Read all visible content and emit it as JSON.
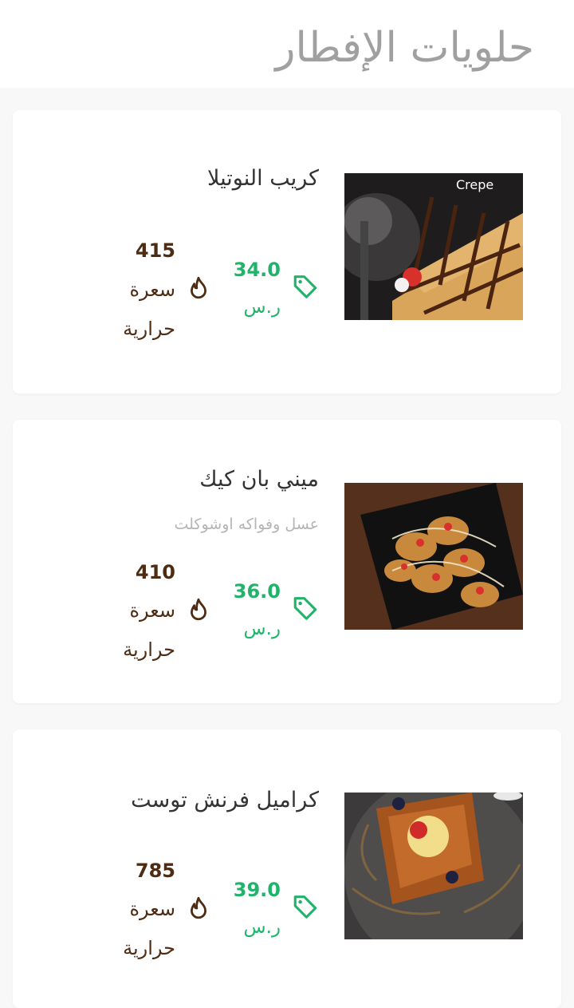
{
  "section": {
    "title": "حلويات الإفطار"
  },
  "colors": {
    "price": "#22b36b",
    "calories": "#4e2c14",
    "title": "#a0a0a0"
  },
  "items": [
    {
      "name": "كريب النوتيلا",
      "description": "",
      "price": "34.0",
      "currency": "ر.س",
      "calories": "415",
      "calories_unit_1": "سعرة",
      "calories_unit_2": "حرارية",
      "image_label": "Crepe"
    },
    {
      "name": "ميني بان كيك",
      "description": "عسل وفواكه اوشوكلت",
      "price": "36.0",
      "currency": "ر.س",
      "calories": "410",
      "calories_unit_1": "سعرة",
      "calories_unit_2": "حرارية"
    },
    {
      "name": "كراميل فرنش توست",
      "description": "",
      "price": "39.0",
      "currency": "ر.س",
      "calories": "785",
      "calories_unit_1": "سعرة",
      "calories_unit_2": "حرارية"
    }
  ]
}
